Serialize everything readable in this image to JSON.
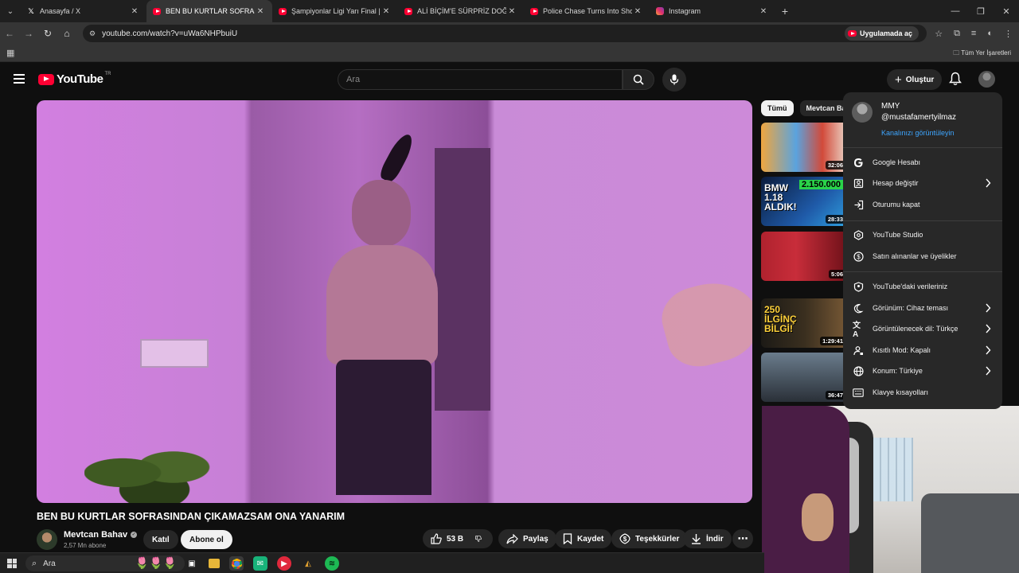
{
  "browser": {
    "tabs": [
      {
        "title": "Anasayfa / X",
        "icon": "x-icon"
      },
      {
        "title": "BEN BU KURTLAR SOFRASINDAN",
        "icon": "youtube-icon",
        "active": true
      },
      {
        "title": "Şampiyonlar Ligi Yarı Final | Atl",
        "icon": "youtube-icon"
      },
      {
        "title": "ALİ BİÇİM'E SÜRPRİZ DOĞUM G",
        "icon": "youtube-icon"
      },
      {
        "title": "Police Chase Turns Into Shootou",
        "icon": "youtube-icon"
      },
      {
        "title": "Instagram",
        "icon": "instagram-icon"
      }
    ],
    "url": "youtube.com/watch?v=uWa6NHPbuiU",
    "open_in_app": "Uygulamada aç",
    "all_bookmarks": "Tüm Yer İşaretleri"
  },
  "youtube": {
    "logo": "YouTube",
    "country": "TR",
    "search_placeholder": "Ara",
    "create_label": "Oluştur"
  },
  "video": {
    "title": "BEN BU KURTLAR SOFRASINDAN ÇIKAMAZSAM ONA YANARIM",
    "channel": "Mevtcan Bahav",
    "subscribers": "2,57 Mn abone",
    "join_label": "Katıl",
    "subscribe_label": "Abone ol",
    "likes": "53 B",
    "share_label": "Paylaş",
    "save_label": "Kaydet",
    "thanks_label": "Teşekkürler",
    "download_label": "İndir"
  },
  "sidebar": {
    "chips": [
      "Tümü",
      "Mevtcan Bah"
    ],
    "thumbs": [
      {
        "duration": "32:06",
        "overlay": ""
      },
      {
        "duration": "28:33",
        "overlay": "BMW 1.18 ALDIK!",
        "overlay2": "2.150.000"
      },
      {
        "duration": "5:06",
        "overlay": ""
      },
      {
        "duration": "1:29:41",
        "overlay": "250 İLGİNÇ BİLGİ!"
      },
      {
        "duration": "36:47",
        "overlay": ""
      }
    ]
  },
  "account_menu": {
    "name": "MMY",
    "handle": "@mustafamertyilmaz",
    "view_channel": "Kanalınızı görüntüleyin",
    "section1": [
      {
        "label": "Google Hesabı",
        "icon": "google-icon",
        "chevron": false
      },
      {
        "label": "Hesap değiştir",
        "icon": "switch-account-icon",
        "chevron": true
      },
      {
        "label": "Oturumu kapat",
        "icon": "sign-out-icon",
        "chevron": false
      }
    ],
    "section2": [
      {
        "label": "YouTube Studio",
        "icon": "studio-icon",
        "chevron": false
      },
      {
        "label": "Satın alınanlar ve üyelikler",
        "icon": "dollar-icon",
        "chevron": false
      }
    ],
    "section3": [
      {
        "label": "YouTube'daki verileriniz",
        "icon": "shield-person-icon",
        "chevron": false
      },
      {
        "label": "Görünüm: Cihaz teması",
        "icon": "moon-icon",
        "chevron": true
      },
      {
        "label": "Görüntülenecek dil: Türkçe",
        "icon": "translate-icon",
        "chevron": true
      },
      {
        "label": "Kısıtlı Mod: Kapalı",
        "icon": "restricted-icon",
        "chevron": true
      },
      {
        "label": "Konum: Türkiye",
        "icon": "globe-icon",
        "chevron": true
      },
      {
        "label": "Klavye kısayolları",
        "icon": "keyboard-icon",
        "chevron": false
      }
    ]
  },
  "taskbar": {
    "search_placeholder": "Ara"
  },
  "colors": {
    "youtube_red": "#ff0033",
    "link_blue": "#3ea6ff",
    "background": "#0f0f0f",
    "menu_bg": "#282828"
  }
}
